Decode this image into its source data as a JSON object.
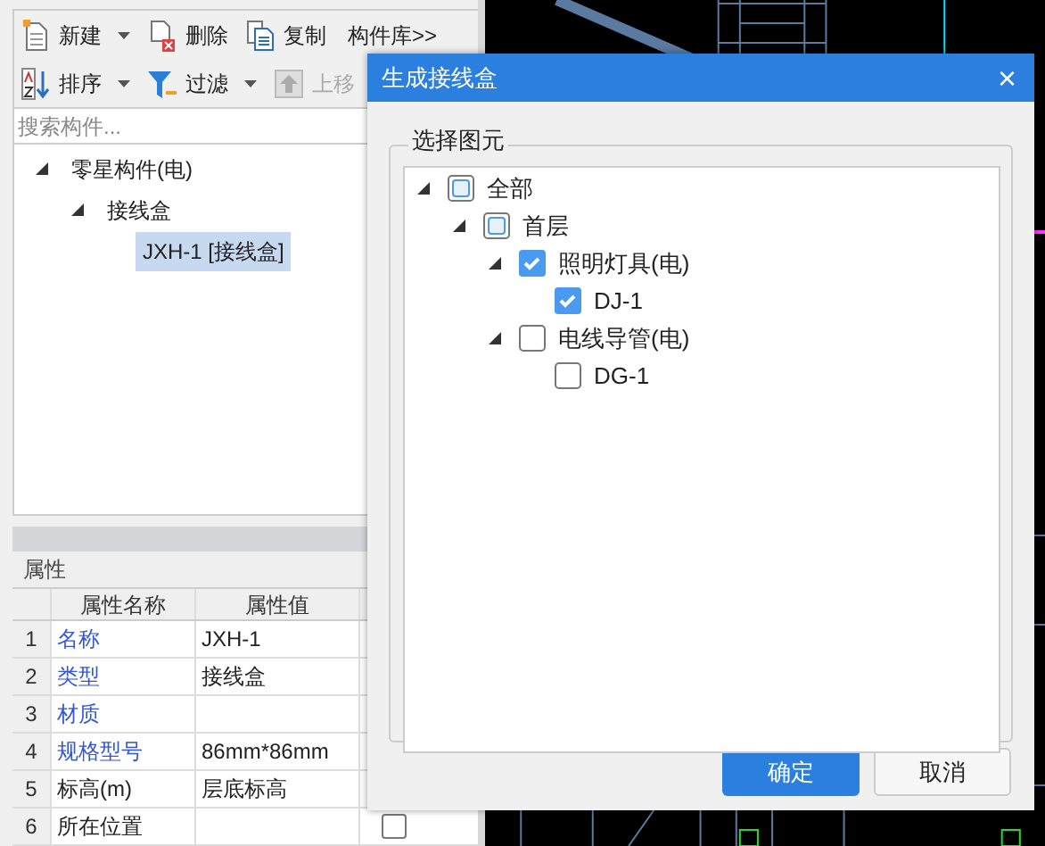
{
  "toolbar": {
    "rows": [
      [
        {
          "label": "新建",
          "dropdown": true,
          "disabled": false
        },
        {
          "label": "删除",
          "dropdown": false,
          "disabled": false
        },
        {
          "label": "复制",
          "dropdown": false,
          "disabled": false
        },
        {
          "label": "构件库>>",
          "dropdown": false,
          "disabled": false
        }
      ],
      [
        {
          "label": "排序",
          "dropdown": true,
          "disabled": false
        },
        {
          "label": "过滤",
          "dropdown": true,
          "disabled": false
        },
        {
          "label": "上移",
          "dropdown": false,
          "disabled": true
        }
      ]
    ]
  },
  "search": {
    "placeholder": "搜索构件..."
  },
  "component_tree": [
    {
      "label": "零星构件(电)",
      "expanded": true,
      "selected": false,
      "children": [
        {
          "label": "接线盒",
          "expanded": true,
          "selected": false,
          "children": [
            {
              "label": "JXH-1 [接线盒]",
              "selected": true
            }
          ]
        }
      ]
    }
  ],
  "properties": {
    "title": "属性",
    "columns": [
      "属性名称",
      "属性值"
    ],
    "rows": [
      {
        "index": "1",
        "name": "名称",
        "value": "JXH-1",
        "linked": true
      },
      {
        "index": "2",
        "name": "类型",
        "value": "接线盒",
        "linked": true
      },
      {
        "index": "3",
        "name": "材质",
        "value": "",
        "linked": true
      },
      {
        "index": "4",
        "name": "规格型号",
        "value": "86mm*86mm",
        "linked": true
      },
      {
        "index": "5",
        "name": "标高(m)",
        "value": "层底标高",
        "linked": false
      },
      {
        "index": "6",
        "name": "所在位置",
        "value": "",
        "linked": false,
        "checked": false
      }
    ]
  },
  "dialog": {
    "title": "生成接线盒",
    "close": "×",
    "group_title": "选择图元",
    "tree": [
      {
        "label": "全部",
        "checked": false,
        "indeterminate": true,
        "expanded": true,
        "children": [
          {
            "label": "首层",
            "checked": false,
            "indeterminate": true,
            "expanded": true,
            "children": [
              {
                "label": "照明灯具(电)",
                "checked": true,
                "indeterminate": false,
                "expanded": true,
                "children": [
                  {
                    "label": "DJ-1",
                    "checked": true,
                    "indeterminate": false
                  }
                ]
              },
              {
                "label": "电线导管(电)",
                "checked": false,
                "indeterminate": false,
                "expanded": true,
                "children": [
                  {
                    "label": "DG-1",
                    "checked": false,
                    "indeterminate": false
                  }
                ]
              }
            ]
          }
        ]
      }
    ],
    "buttons": [
      {
        "label": "确定",
        "kind": "primary"
      },
      {
        "label": "取消",
        "kind": "secondary"
      }
    ]
  }
}
